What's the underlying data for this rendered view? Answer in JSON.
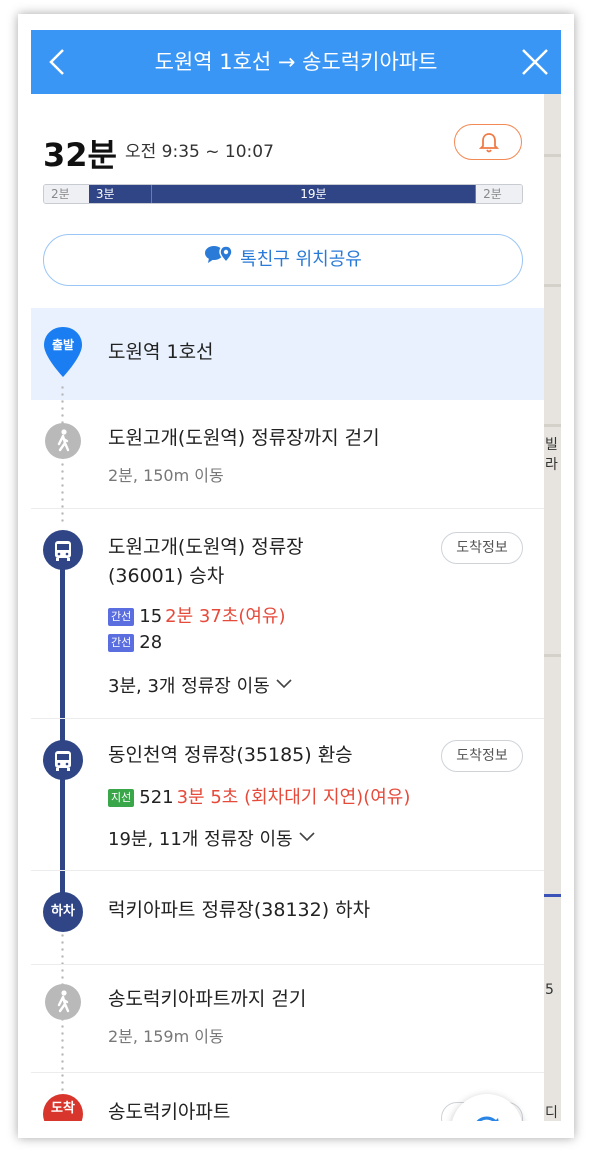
{
  "header": {
    "title": "도원역 1호선 → 송도럭키아파트",
    "back_icon": "chevron-left-icon",
    "close_icon": "close-icon",
    "color": "#3a96f5"
  },
  "summary": {
    "total": "32분",
    "time_range": "오전 9:35 ~ 10:07",
    "alarm_icon": "bell-icon",
    "segments": [
      "2분",
      "3분",
      "19분",
      "2분"
    ],
    "share_label": "톡친구 위치공유"
  },
  "map": {
    "labels": [
      "빌라",
      "5",
      "디"
    ]
  },
  "route": {
    "start": {
      "badge": "출발",
      "title": "도원역 1호선"
    },
    "walk1": {
      "title": "도원고개(도원역) 정류장까지 걷기",
      "sub": "2분, 150m 이동"
    },
    "board": {
      "title_line1": "도원고개(도원역) 정류장",
      "title_line2": "(36001) 승차",
      "info_label": "도착정보",
      "buses": [
        {
          "type": "간선",
          "number": "15",
          "arrival": "2분 37초(여유)"
        },
        {
          "type": "간선",
          "number": "28",
          "arrival": ""
        }
      ],
      "move": "3분, 3개 정류장 이동"
    },
    "transfer": {
      "title": "동인천역 정류장(35185) 환승",
      "info_label": "도착정보",
      "bus": {
        "type": "지선",
        "number": "521",
        "arrival": "3분 5초 (회차대기 지연)(여유)"
      },
      "move": "19분, 11개 정류장 이동"
    },
    "alight": {
      "badge": "하차",
      "title": "럭키아파트 정류장(38132) 하차"
    },
    "walk2": {
      "title": "송도럭키아파트까지 걷기",
      "sub": "2분, 159m 이동"
    },
    "end": {
      "badge": "도착",
      "title": "송도럭키아파트"
    }
  },
  "colors": {
    "trunk_chip": "#5a6ee0",
    "branch_chip": "#3aa64a",
    "bus_line": "#2f4586",
    "arrival_red": "#e64a3a"
  }
}
